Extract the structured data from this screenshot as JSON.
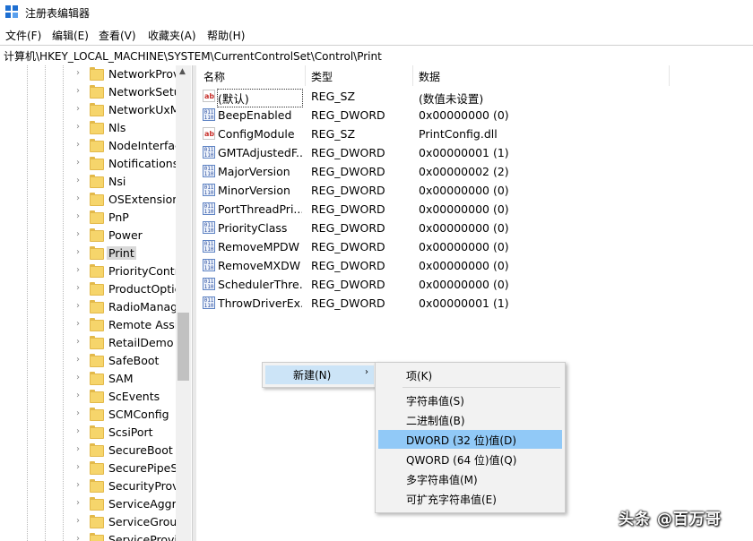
{
  "window": {
    "title": "注册表编辑器"
  },
  "menu": [
    "文件(F)",
    "编辑(E)",
    "查看(V)",
    "收藏夹(A)",
    "帮助(H)"
  ],
  "address": "计算机\\HKEY_LOCAL_MACHINE\\SYSTEM\\CurrentControlSet\\Control\\Print",
  "tree": {
    "selected": "Print",
    "items": [
      "NetworkProv",
      "NetworkSetu",
      "NetworkUxM",
      "Nls",
      "NodeInterfac",
      "Notifications",
      "Nsi",
      "OSExtensionI",
      "PnP",
      "Power",
      "Print",
      "PriorityContr",
      "ProductOptic",
      "RadioManag",
      "Remote Assis",
      "RetailDemo",
      "SafeBoot",
      "SAM",
      "ScEvents",
      "SCMConfig",
      "ScsiPort",
      "SecureBoot",
      "SecurePipeSe",
      "SecurityProvi",
      "ServiceAggre",
      "ServiceGroup",
      "ServiceProvic"
    ]
  },
  "list": {
    "columns": [
      "名称",
      "类型",
      "数据"
    ],
    "rows": [
      {
        "icon": "string-value-icon",
        "name": "(默认)",
        "type": "REG_SZ",
        "data": "(数值未设置)"
      },
      {
        "icon": "binary-value-icon",
        "name": "BeepEnabled",
        "type": "REG_DWORD",
        "data": "0x00000000 (0)"
      },
      {
        "icon": "string-value-icon",
        "name": "ConfigModule",
        "type": "REG_SZ",
        "data": "PrintConfig.dll"
      },
      {
        "icon": "binary-value-icon",
        "name": "GMTAdjustedF...",
        "type": "REG_DWORD",
        "data": "0x00000001 (1)"
      },
      {
        "icon": "binary-value-icon",
        "name": "MajorVersion",
        "type": "REG_DWORD",
        "data": "0x00000002 (2)"
      },
      {
        "icon": "binary-value-icon",
        "name": "MinorVersion",
        "type": "REG_DWORD",
        "data": "0x00000000 (0)"
      },
      {
        "icon": "binary-value-icon",
        "name": "PortThreadPri...",
        "type": "REG_DWORD",
        "data": "0x00000000 (0)"
      },
      {
        "icon": "binary-value-icon",
        "name": "PriorityClass",
        "type": "REG_DWORD",
        "data": "0x00000000 (0)"
      },
      {
        "icon": "binary-value-icon",
        "name": "RemoveMPDW",
        "type": "REG_DWORD",
        "data": "0x00000000 (0)"
      },
      {
        "icon": "binary-value-icon",
        "name": "RemoveMXDW",
        "type": "REG_DWORD",
        "data": "0x00000000 (0)"
      },
      {
        "icon": "binary-value-icon",
        "name": "SchedulerThre...",
        "type": "REG_DWORD",
        "data": "0x00000000 (0)"
      },
      {
        "icon": "binary-value-icon",
        "name": "ThrowDriverEx...",
        "type": "REG_DWORD",
        "data": "0x00000001 (1)"
      }
    ]
  },
  "context_menu": {
    "parent_label": "新建(N)",
    "parent_arrow": "›",
    "items": [
      "项(K)",
      "字符串值(S)",
      "二进制值(B)",
      "DWORD (32 位)值(D)",
      "QWORD (64 位)值(Q)",
      "多字符串值(M)",
      "可扩充字符串值(E)"
    ],
    "highlighted": "DWORD (32 位)值(D)"
  },
  "watermark": "头条 @百万哥",
  "icons": {
    "string_glyph": "ab",
    "binary_glyph": "011 110"
  },
  "colors": {
    "highlight": "#91c9f7",
    "parent_highlight": "#cce4f7",
    "folder": "#f6d56b",
    "accent": "#1e6fd1"
  }
}
